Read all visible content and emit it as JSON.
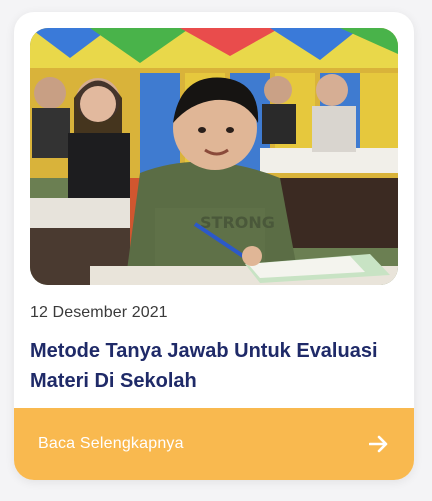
{
  "card": {
    "image_alt": "Students in a classroom",
    "date": "12 Desember 2021",
    "title": "Metode Tanya Jawab Untuk Evaluasi Materi Di Sekolah",
    "cta_label": "Baca Selengkapnya",
    "cta_icon": "arrow-right-icon"
  },
  "colors": {
    "title": "#1f2a68",
    "accent": "#f9b94f",
    "cta_text": "#ffffff"
  }
}
